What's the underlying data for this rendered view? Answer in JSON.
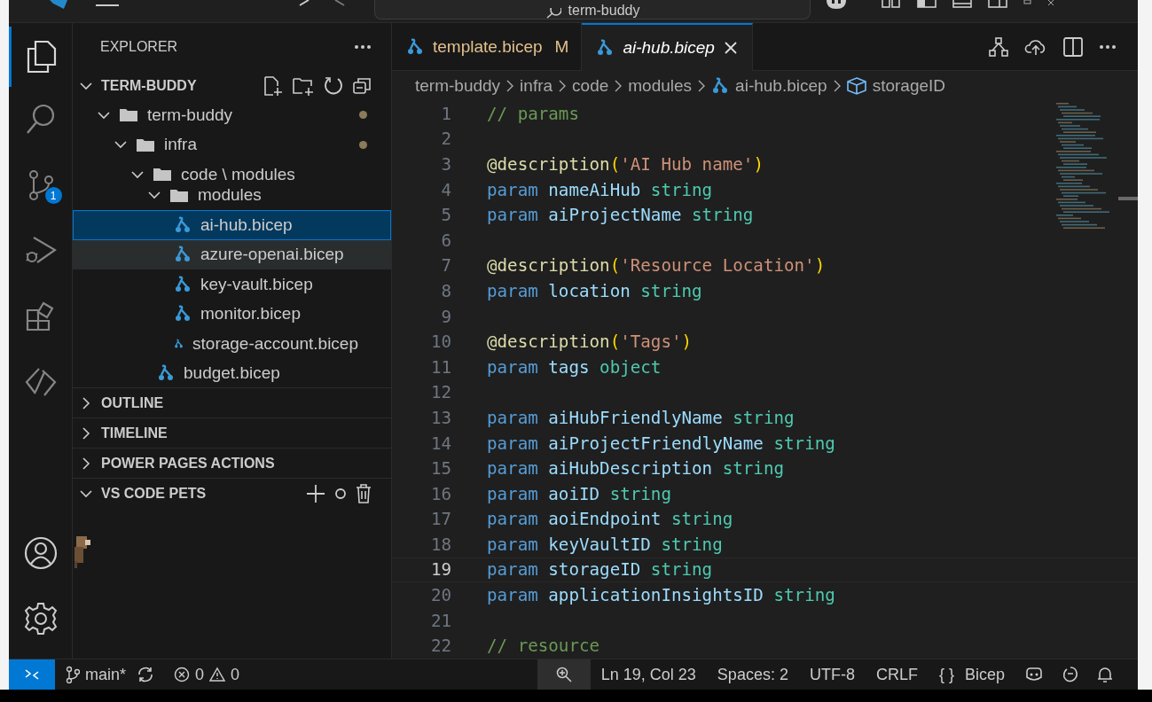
{
  "title_bar": {
    "search": "term-buddy"
  },
  "sidebar": {
    "title": "EXPLORER",
    "root": {
      "label": "TERM-BUDDY",
      "expanded": true
    },
    "tree": [
      {
        "label": "term-buddy",
        "kind": "folder",
        "expanded": true,
        "modified": true,
        "selected": false,
        "hovered": false,
        "children": [
          {
            "label": "infra",
            "kind": "folder",
            "expanded": true,
            "modified": true,
            "selected": false,
            "hovered": false,
            "children": [
              {
                "label": "code \\ modules",
                "kind": "folder",
                "expanded": true,
                "modified": false,
                "selected": false,
                "hovered": false,
                "children": [
                  {
                    "label": "modules",
                    "kind": "folder",
                    "expanded": true,
                    "modified": false,
                    "selected": false,
                    "hovered": false,
                    "children": [
                      {
                        "label": "ai-hub.bicep",
                        "kind": "file",
                        "modified": false,
                        "selected": true,
                        "hovered": false
                      },
                      {
                        "label": "azure-openai.bicep",
                        "kind": "file",
                        "modified": false,
                        "selected": false,
                        "hovered": true
                      },
                      {
                        "label": "key-vault.bicep",
                        "kind": "file",
                        "modified": false,
                        "selected": false,
                        "hovered": false
                      },
                      {
                        "label": "monitor.bicep",
                        "kind": "file",
                        "modified": false,
                        "selected": false,
                        "hovered": false
                      },
                      {
                        "label": "storage-account.bicep",
                        "kind": "file",
                        "modified": false,
                        "selected": false,
                        "hovered": false
                      }
                    ]
                  },
                  {
                    "label": "budget.bicep",
                    "kind": "file",
                    "modified": false,
                    "selected": false,
                    "hovered": false
                  }
                ]
              }
            ]
          }
        ]
      }
    ],
    "sections": [
      {
        "label": "OUTLINE",
        "expanded": false
      },
      {
        "label": "TIMELINE",
        "expanded": false
      },
      {
        "label": "POWER PAGES ACTIONS",
        "expanded": false
      },
      {
        "label": "VS CODE PETS",
        "expanded": true
      }
    ]
  },
  "activity_bar": {
    "items": [
      {
        "kind": "files",
        "selected": true
      },
      {
        "kind": "search",
        "selected": false
      },
      {
        "kind": "git",
        "selected": false,
        "badge": "1"
      },
      {
        "kind": "run",
        "selected": false
      },
      {
        "kind": "extensions",
        "selected": false
      },
      {
        "kind": "remote",
        "selected": false
      }
    ]
  },
  "tabs": [
    {
      "label": "template.bicep",
      "status": "M",
      "selected": false
    },
    {
      "label": "ai-hub.bicep",
      "selected": true
    }
  ],
  "breadcrumbs": [
    "term-buddy",
    "infra",
    "code",
    "modules",
    "ai-hub.bicep",
    "storageID"
  ],
  "editor": {
    "lines": [
      {
        "number": "1",
        "current": false,
        "tokens": [
          {
            "kind": "comment",
            "text": "// params"
          }
        ]
      },
      {
        "number": "2",
        "current": false
      },
      {
        "number": "3",
        "current": false,
        "tokens": [
          {
            "kind": "decorator",
            "text": "@description"
          },
          {
            "kind": "punct",
            "text": "("
          },
          {
            "kind": "string",
            "text": "'AI Hub name'"
          },
          {
            "kind": "punct",
            "text": ")"
          }
        ]
      },
      {
        "number": "4",
        "current": false,
        "tokens": [
          {
            "kind": "keyword",
            "text": "param"
          },
          {
            "kind": "ident",
            "text": " nameAiHub"
          },
          {
            "kind": "type",
            "text": " string"
          }
        ]
      },
      {
        "number": "5",
        "current": false,
        "tokens": [
          {
            "kind": "keyword",
            "text": "param"
          },
          {
            "kind": "ident",
            "text": " aiProjectName"
          },
          {
            "kind": "type",
            "text": " string"
          }
        ]
      },
      {
        "number": "6",
        "current": false
      },
      {
        "number": "7",
        "current": false,
        "tokens": [
          {
            "kind": "decorator",
            "text": "@description"
          },
          {
            "kind": "punct",
            "text": "("
          },
          {
            "kind": "string",
            "text": "'Resource Location'"
          },
          {
            "kind": "punct",
            "text": ")"
          }
        ]
      },
      {
        "number": "8",
        "current": false,
        "tokens": [
          {
            "kind": "keyword",
            "text": "param"
          },
          {
            "kind": "ident",
            "text": " location"
          },
          {
            "kind": "type",
            "text": " string"
          }
        ]
      },
      {
        "number": "9",
        "current": false
      },
      {
        "number": "10",
        "current": false,
        "tokens": [
          {
            "kind": "decorator",
            "text": "@description"
          },
          {
            "kind": "punct",
            "text": "("
          },
          {
            "kind": "string",
            "text": "'Tags'"
          },
          {
            "kind": "punct",
            "text": ")"
          }
        ]
      },
      {
        "number": "11",
        "current": false,
        "tokens": [
          {
            "kind": "keyword",
            "text": "param"
          },
          {
            "kind": "ident",
            "text": " tags"
          },
          {
            "kind": "type",
            "text": " object"
          }
        ]
      },
      {
        "number": "12",
        "current": false
      },
      {
        "number": "13",
        "current": false,
        "tokens": [
          {
            "kind": "keyword",
            "text": "param"
          },
          {
            "kind": "ident",
            "text": " aiHubFriendlyName"
          },
          {
            "kind": "type",
            "text": " string"
          }
        ]
      },
      {
        "number": "14",
        "current": false,
        "tokens": [
          {
            "kind": "keyword",
            "text": "param"
          },
          {
            "kind": "ident",
            "text": " aiProjectFriendlyName"
          },
          {
            "kind": "type",
            "text": " string"
          }
        ]
      },
      {
        "number": "15",
        "current": false,
        "tokens": [
          {
            "kind": "keyword",
            "text": "param"
          },
          {
            "kind": "ident",
            "text": " aiHubDescription"
          },
          {
            "kind": "type",
            "text": " string"
          }
        ]
      },
      {
        "number": "16",
        "current": false,
        "tokens": [
          {
            "kind": "keyword",
            "text": "param"
          },
          {
            "kind": "ident",
            "text": " aoiID"
          },
          {
            "kind": "type",
            "text": " string"
          }
        ]
      },
      {
        "number": "17",
        "current": false,
        "tokens": [
          {
            "kind": "keyword",
            "text": "param"
          },
          {
            "kind": "ident",
            "text": " aoiEndpoint"
          },
          {
            "kind": "type",
            "text": " string"
          }
        ]
      },
      {
        "number": "18",
        "current": false,
        "tokens": [
          {
            "kind": "keyword",
            "text": "param"
          },
          {
            "kind": "ident",
            "text": " keyVaultID"
          },
          {
            "kind": "type",
            "text": " string"
          }
        ]
      },
      {
        "number": "19",
        "current": true,
        "tokens": [
          {
            "kind": "keyword",
            "text": "param"
          },
          {
            "kind": "ident",
            "text": " storageID"
          },
          {
            "kind": "type",
            "text": " string"
          }
        ]
      },
      {
        "number": "20",
        "current": false,
        "tokens": [
          {
            "kind": "keyword",
            "text": "param"
          },
          {
            "kind": "ident",
            "text": " applicationInsightsID"
          },
          {
            "kind": "type",
            "text": " string"
          }
        ]
      },
      {
        "number": "21",
        "current": false
      },
      {
        "number": "22",
        "current": false,
        "tokens": [
          {
            "kind": "comment",
            "text": "// resource"
          }
        ]
      }
    ]
  },
  "status_bar": {
    "branch": "main*",
    "errors": "0",
    "warnings": "0",
    "position": "Ln 19, Col 23",
    "spaces": "Spaces: 2",
    "encoding": "UTF-8",
    "eol": "CRLF",
    "language_icon": "{ }",
    "language": "Bicep"
  }
}
